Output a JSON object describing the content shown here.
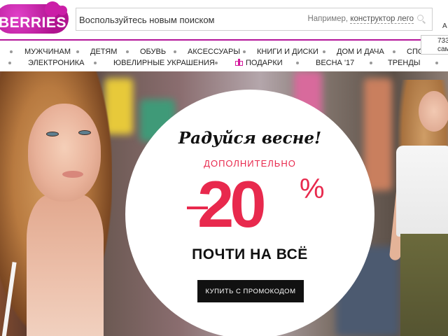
{
  "brand": {
    "logo_text": "BERRIES"
  },
  "search": {
    "placeholder": "Воспользуйтесь новым поиском",
    "hint_prefix": "Например,",
    "hint_example": "конструктор лего",
    "icon": "search-icon"
  },
  "header": {
    "right_truncated": "А"
  },
  "nav": {
    "row1": [
      "Мужчинам",
      "Детям",
      "Обувь",
      "Аксессуары",
      "Книги и диски",
      "Дом и дача",
      "Спо"
    ],
    "row2": [
      "Электроника",
      "Ювелирные украшения",
      "Подарки",
      "Весна '17",
      "Тренды"
    ],
    "gift_icon": "gift-icon",
    "accent_color": "#b4169a"
  },
  "tooltip": {
    "line1": "733",
    "line2": "само"
  },
  "promo": {
    "headline": "Радуйся весне!",
    "subheadline": "Дополнительно",
    "discount_number": "20",
    "discount_sign": "%",
    "tagline": "ПОЧТИ НА ВСЁ",
    "button_label": "Купить с промокодом",
    "accent_color": "#e8294d"
  }
}
